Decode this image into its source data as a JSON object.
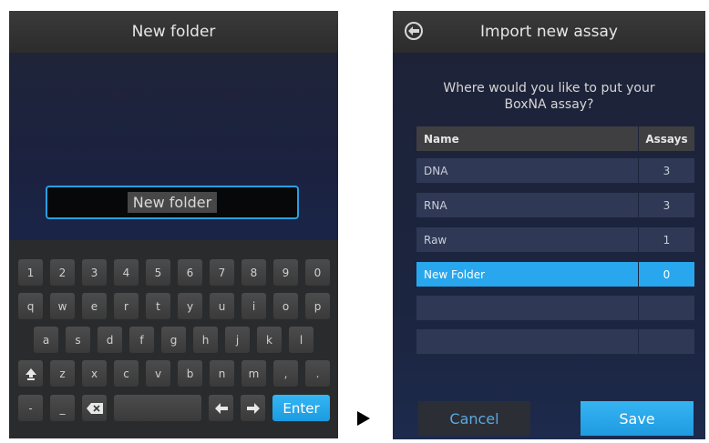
{
  "left": {
    "title": "New folder",
    "input_value": "New folder",
    "keyboard": {
      "row1": [
        "1",
        "2",
        "3",
        "4",
        "5",
        "6",
        "7",
        "8",
        "9",
        "0"
      ],
      "row2": [
        "q",
        "w",
        "e",
        "r",
        "t",
        "y",
        "u",
        "i",
        "o",
        "p"
      ],
      "row3": [
        "a",
        "s",
        "d",
        "f",
        "g",
        "h",
        "j",
        "k",
        "l"
      ],
      "row4": [
        "z",
        "x",
        "c",
        "v",
        "b",
        "n",
        "m",
        ",",
        "."
      ],
      "dash": "-",
      "underscore": "_",
      "enter": "Enter"
    }
  },
  "right": {
    "title": "Import new assay",
    "question": "Where would you like to put your BoxNA assay?",
    "table": {
      "headers": [
        "Name",
        "Assays"
      ],
      "rows": [
        {
          "name": "DNA",
          "assays": "3"
        },
        {
          "name": "RNA",
          "assays": "3"
        },
        {
          "name": "Raw",
          "assays": "1"
        },
        {
          "name": "New Folder",
          "assays": "0"
        }
      ]
    },
    "cancel_label": "Cancel",
    "save_label": "Save"
  },
  "colors": {
    "accent": "#29a7ee",
    "header_bg": "#333333",
    "panel_bg": "#1c2440"
  }
}
